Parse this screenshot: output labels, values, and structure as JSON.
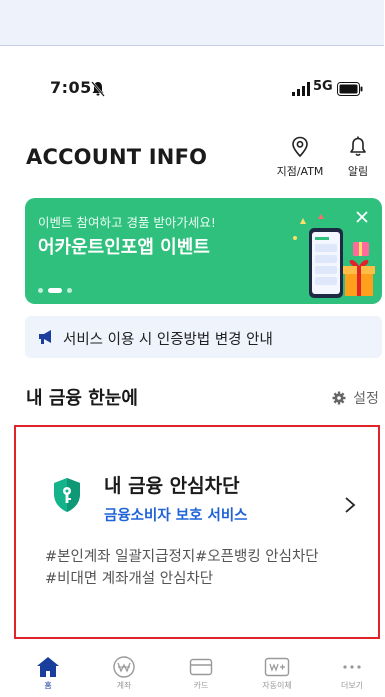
{
  "status_bar": {
    "time": "7:05",
    "network": "5G"
  },
  "header": {
    "title": "ACCOUNT INFO",
    "atm_label": "지점/ATM",
    "alarm_label": "알림"
  },
  "banner": {
    "subtitle": "이벤트 참여하고 경품 받아가세요!",
    "title": "어카운트인포앱 이벤트"
  },
  "notice": {
    "text": "서비스 이용 시 인증방법 변경 안내"
  },
  "section": {
    "title": "내 금융 한눈에",
    "settings_label": "설정"
  },
  "card": {
    "title": "내 금융 안심차단",
    "subtitle": "금융소비자 보호 서비스",
    "tags": [
      "#본인계좌 일괄지급정지#오픈뱅킹 안심차단",
      "#비대면 계좌개설 안심차단"
    ]
  },
  "tabs": [
    {
      "label": "홈",
      "icon": "home-icon"
    },
    {
      "label": "계좌",
      "icon": "won-icon"
    },
    {
      "label": "카드",
      "icon": "card-icon"
    },
    {
      "label": "자동이체",
      "icon": "transfer-icon"
    },
    {
      "label": "더보기",
      "icon": "more-icon"
    }
  ],
  "colors": {
    "accent": "#1a3e9c",
    "banner": "#2fc07e",
    "highlight_border": "#e0242a",
    "link": "#1f63d9"
  }
}
